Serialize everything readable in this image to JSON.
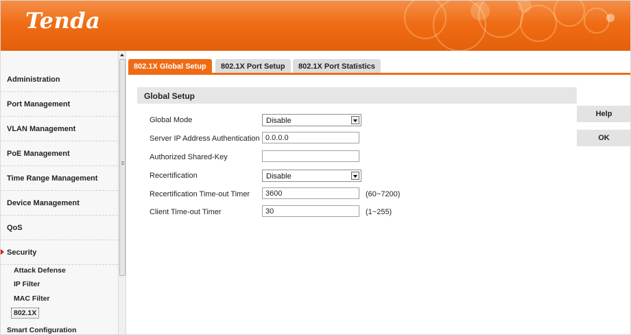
{
  "header": {
    "logo_text": "Tenda",
    "brand_color": "#ef6b15"
  },
  "sidebar": {
    "items": [
      {
        "label": "Administration"
      },
      {
        "label": "Port Management"
      },
      {
        "label": "VLAN Management"
      },
      {
        "label": "PoE Management"
      },
      {
        "label": "Time Range Management"
      },
      {
        "label": "Device Management"
      },
      {
        "label": "QoS"
      },
      {
        "label": "Security",
        "active": true
      }
    ],
    "sub_items": [
      {
        "label": "Attack Defense"
      },
      {
        "label": "IP Filter"
      },
      {
        "label": "MAC Filter"
      },
      {
        "label": "802.1X",
        "current": true
      }
    ],
    "last_item": {
      "label": "Smart Configuration"
    },
    "active_marker_icon": "triangle-right-icon"
  },
  "tabs": [
    {
      "label": "802.1X Global Setup",
      "active": true
    },
    {
      "label": "802.1X Port Setup"
    },
    {
      "label": "802.1X Port Statistics"
    }
  ],
  "section": {
    "title": "Global Setup"
  },
  "form": {
    "global_mode": {
      "label": "Global Mode",
      "value": "Disable"
    },
    "server_ip": {
      "label": "Server IP Address Authentication",
      "value": "0.0.0.0"
    },
    "shared_key": {
      "label": "Authorized Shared-Key",
      "value": ""
    },
    "recertification": {
      "label": "Recertification",
      "value": "Disable"
    },
    "recert_timer": {
      "label": "Recertification Time-out Timer",
      "value": "3600",
      "range": "(60~7200)"
    },
    "client_timer": {
      "label": "Client Time-out Timer",
      "value": "30",
      "range": "(1~255)"
    }
  },
  "buttons": {
    "help": "Help",
    "ok": "OK"
  }
}
